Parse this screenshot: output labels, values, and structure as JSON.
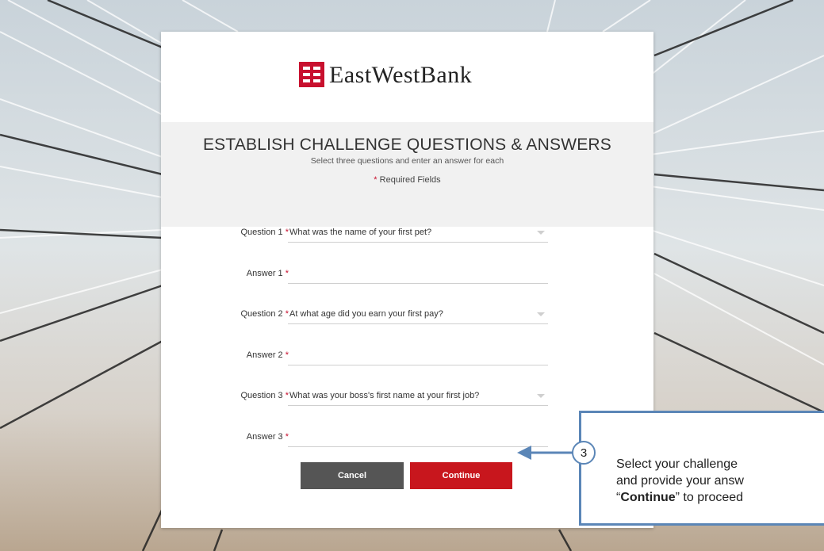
{
  "brand": {
    "name": "EastWestBank",
    "color": "#c8102e"
  },
  "page": {
    "title": "ESTABLISH CHALLENGE QUESTIONS & ANSWERS",
    "subtitle": "Select three questions and enter an answer for each",
    "required_note": "Required Fields",
    "required_marker": "*"
  },
  "form": {
    "rows": [
      {
        "label": "Question 1",
        "value": "What was the name of your first pet?"
      },
      {
        "label": "Answer 1",
        "value": ""
      },
      {
        "label": "Question 2",
        "value": "At what age did you earn your first pay?"
      },
      {
        "label": "Answer 2",
        "value": ""
      },
      {
        "label": "Question 3",
        "value": "What was your boss's first name at your first job?"
      },
      {
        "label": "Answer 3",
        "value": ""
      }
    ]
  },
  "buttons": {
    "cancel": "Cancel",
    "continue": "Continue",
    "cancel_color": "#555555",
    "continue_color": "#c8161d"
  },
  "callout": {
    "step": "3",
    "line1": "Select your challenge",
    "line2": "and provide your answ",
    "line3_prefix": "“",
    "line3_bold": "Continue",
    "line3_suffix": "” to proceed",
    "border_color": "#5b86b7"
  }
}
